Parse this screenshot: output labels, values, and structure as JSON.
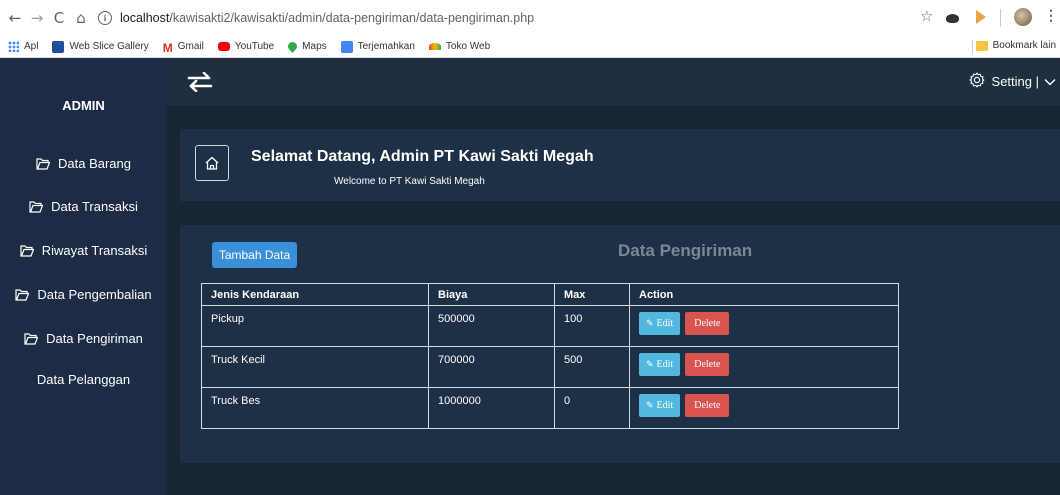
{
  "browser": {
    "url_host": "localhost",
    "url_path": "/kawisakti2/kawisakti/admin/data-pengiriman/data-pengiriman.php",
    "bookmarks": [
      {
        "label": "Apl",
        "color": "#4285f4"
      },
      {
        "label": "Web Slice Gallery",
        "color": "#1e4e9c"
      },
      {
        "label": "Gmail",
        "color": "#d93025"
      },
      {
        "label": "YouTube",
        "color": "#ff0000"
      },
      {
        "label": "Maps",
        "color": "#34a853"
      },
      {
        "label": "Terjemahkan",
        "color": "#4285f4"
      },
      {
        "label": "Toko Web",
        "color": "#e8a44a"
      }
    ],
    "bookmark_other": "Bookmark lain"
  },
  "sidebar": {
    "title": "ADMIN",
    "items": [
      {
        "label": "Data Barang",
        "icon": "folder-open-icon"
      },
      {
        "label": "Data Transaksi",
        "icon": "folder-open-icon"
      },
      {
        "label": "Riwayat Transaksi",
        "icon": "folder-open-icon"
      },
      {
        "label": "Data Pengembalian",
        "icon": "folder-open-icon"
      },
      {
        "label": "Data Pengiriman",
        "icon": "folder-open-icon"
      },
      {
        "label": "Data Pelanggan",
        "icon": ""
      }
    ]
  },
  "topbar": {
    "setting_label": "Setting |"
  },
  "welcome": {
    "title": "Selamat Datang, Admin PT Kawi Sakti Megah",
    "subtitle": "Welcome to PT Kawi Sakti Megah"
  },
  "panel": {
    "add_label": "Tambah Data",
    "title": "Data Pengiriman",
    "columns": [
      "Jenis Kendaraan",
      "Biaya",
      "Max",
      "Action"
    ],
    "rows": [
      {
        "jenis": "Pickup",
        "biaya": "500000",
        "max": "100"
      },
      {
        "jenis": "Truck Kecil",
        "biaya": "700000",
        "max": "500"
      },
      {
        "jenis": "Truck Bes",
        "biaya": "1000000",
        "max": "0"
      }
    ],
    "edit_label": "Edit",
    "delete_label": "Delete"
  },
  "colors": {
    "sidebar_bg": "#1d2b45",
    "topbar_bg": "#1f2f40",
    "panel_bg": "#1e3045",
    "primary": "#3a8fd9",
    "info": "#52b8de",
    "danger": "#d9534f"
  }
}
